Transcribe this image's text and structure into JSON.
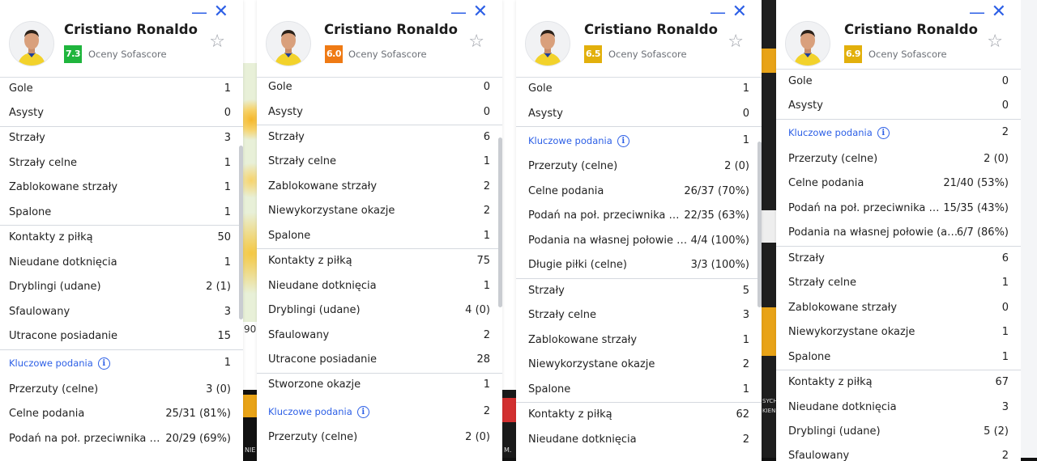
{
  "brand": {
    "accent": "#2c5fe6"
  },
  "background": {
    "p1_snippet": "90",
    "p1_bottom": "NIE",
    "p2_bottom": "M.",
    "p4_side1": "SYCH",
    "p4_side2": "KIEN"
  },
  "panels": [
    {
      "player": "Cristiano Ronaldo",
      "rating": "7.3",
      "rating_color": "#1fb53d",
      "rating_source": "Oceny Sofascore",
      "rows": [
        {
          "label": "Gole",
          "value": "1"
        },
        {
          "label": "Asysty",
          "value": "0"
        },
        {
          "label": "Strzały",
          "value": "3"
        },
        {
          "label": "Strzały celne",
          "value": "1"
        },
        {
          "label": "Zablokowane strzały",
          "value": "1"
        },
        {
          "label": "Spalone",
          "value": "1"
        },
        {
          "label": "Kontakty z piłką",
          "value": "50"
        },
        {
          "label": "Nieudane dotknięcia",
          "value": "1"
        },
        {
          "label": "Dryblingi (udane)",
          "value": "2 (1)"
        },
        {
          "label": "Sfaulowany",
          "value": "3"
        },
        {
          "label": "Utracone posiadanie",
          "value": "15"
        },
        {
          "label": "Kluczowe podania",
          "value": "1"
        },
        {
          "label": "Przerzuty (celne)",
          "value": "3 (0)"
        },
        {
          "label": "Celne podania",
          "value": "25/31 (81%)"
        },
        {
          "label": "Podań na poł. przeciwnika (acc.)",
          "value": "20/29 (69%)"
        }
      ]
    },
    {
      "player": "Cristiano Ronaldo",
      "rating": "6.0",
      "rating_color": "#ef7a14",
      "rating_source": "Oceny Sofascore",
      "rows": [
        {
          "label": "Gole",
          "value": "0"
        },
        {
          "label": "Asysty",
          "value": "0"
        },
        {
          "label": "Strzały",
          "value": "6"
        },
        {
          "label": "Strzały celne",
          "value": "1"
        },
        {
          "label": "Zablokowane strzały",
          "value": "2"
        },
        {
          "label": "Niewykorzystane okazje",
          "value": "2"
        },
        {
          "label": "Spalone",
          "value": "1"
        },
        {
          "label": "Kontakty z piłką",
          "value": "75"
        },
        {
          "label": "Nieudane dotknięcia",
          "value": "1"
        },
        {
          "label": "Dryblingi (udane)",
          "value": "4 (0)"
        },
        {
          "label": "Sfaulowany",
          "value": "2"
        },
        {
          "label": "Utracone posiadanie",
          "value": "28"
        },
        {
          "label": "Stworzone okazje",
          "value": "1"
        },
        {
          "label": "Kluczowe podania",
          "value": "2"
        },
        {
          "label": "Przerzuty (celne)",
          "value": "2 (0)"
        }
      ]
    },
    {
      "player": "Cristiano Ronaldo",
      "rating": "6.5",
      "rating_color": "#e2b00c",
      "rating_source": "Oceny Sofascore",
      "rows": [
        {
          "label": "Gole",
          "value": "1"
        },
        {
          "label": "Asysty",
          "value": "0"
        },
        {
          "label": "Kluczowe podania",
          "value": "1"
        },
        {
          "label": "Przerzuty (celne)",
          "value": "2 (0)"
        },
        {
          "label": "Celne podania",
          "value": "26/37 (70%)"
        },
        {
          "label": "Podań na poł. przeciwnika (acc.)",
          "value": "22/35 (63%)"
        },
        {
          "label": "Podania na własnej połowie (acc.)",
          "value": "4/4 (100%)"
        },
        {
          "label": "Długie piłki (celne)",
          "value": "3/3 (100%)"
        },
        {
          "label": "Strzały",
          "value": "5"
        },
        {
          "label": "Strzały celne",
          "value": "3"
        },
        {
          "label": "Zablokowane strzały",
          "value": "1"
        },
        {
          "label": "Niewykorzystane okazje",
          "value": "2"
        },
        {
          "label": "Spalone",
          "value": "1"
        },
        {
          "label": "Kontakty z piłką",
          "value": "62"
        },
        {
          "label": "Nieudane dotknięcia",
          "value": "2"
        }
      ]
    },
    {
      "player": "Cristiano Ronaldo",
      "rating": "6.9",
      "rating_color": "#e2b00c",
      "rating_source": "Oceny Sofascore",
      "rows": [
        {
          "label": "Gole",
          "value": "0"
        },
        {
          "label": "Asysty",
          "value": "0"
        },
        {
          "label": "Kluczowe podania",
          "value": "2"
        },
        {
          "label": "Przerzuty (celne)",
          "value": "2 (0)"
        },
        {
          "label": "Celne podania",
          "value": "21/40 (53%)"
        },
        {
          "label": "Podań na poł. przeciwnika (acc.)",
          "value": "15/35 (43%)"
        },
        {
          "label": "Podania na własnej połowie (acc.)",
          "value": "6/7 (86%)"
        },
        {
          "label": "Strzały",
          "value": "6"
        },
        {
          "label": "Strzały celne",
          "value": "1"
        },
        {
          "label": "Zablokowane strzały",
          "value": "0"
        },
        {
          "label": "Niewykorzystane okazje",
          "value": "1"
        },
        {
          "label": "Spalone",
          "value": "1"
        },
        {
          "label": "Kontakty z piłką",
          "value": "67"
        },
        {
          "label": "Nieudane dotknięcia",
          "value": "3"
        },
        {
          "label": "Dryblingi (udane)",
          "value": "5 (2)"
        },
        {
          "label": "Sfaulowany",
          "value": "2"
        }
      ]
    }
  ],
  "window": {
    "minimize_icon": "minimize-icon",
    "close_icon": "close-icon",
    "favorite_icon": "star-icon",
    "info_icon": "info-icon"
  }
}
